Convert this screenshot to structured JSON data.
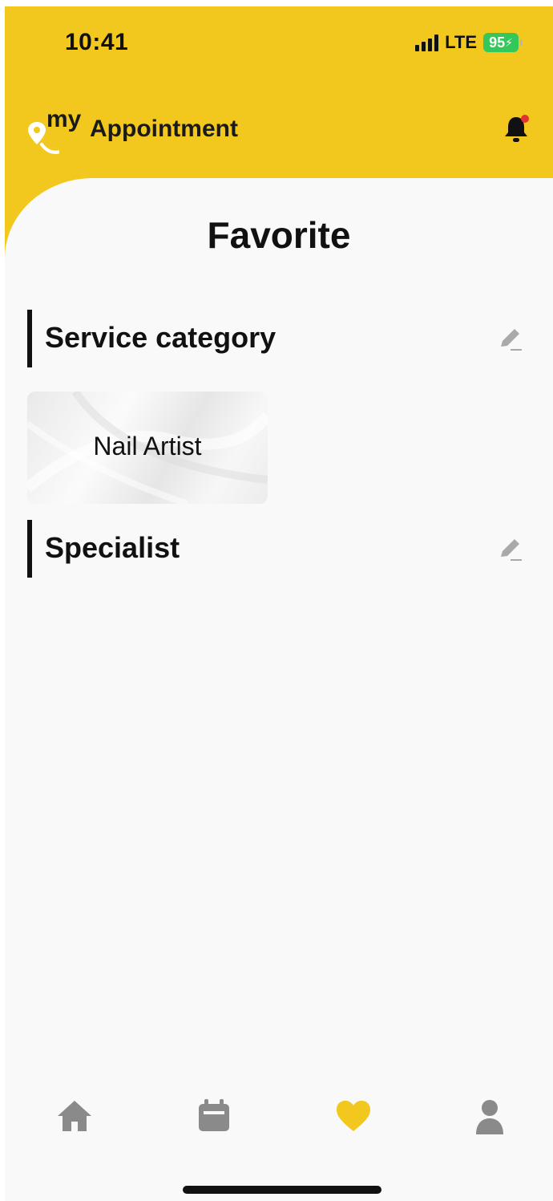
{
  "status_bar": {
    "time": "10:41",
    "network": "LTE",
    "battery": "95"
  },
  "header": {
    "logo_prefix": "my",
    "logo_main": "Appointment",
    "brand_color": "#f2c81e"
  },
  "page": {
    "title": "Favorite"
  },
  "sections": {
    "service_category": {
      "title": "Service category",
      "cards": [
        {
          "label": "Nail Artist"
        }
      ]
    },
    "specialist": {
      "title": "Specialist"
    }
  },
  "tabbar": {
    "items": [
      {
        "icon": "home-icon",
        "active": false
      },
      {
        "icon": "calendar-icon",
        "active": false
      },
      {
        "icon": "heart-icon",
        "active": true
      },
      {
        "icon": "profile-icon",
        "active": false
      }
    ],
    "active_color": "#f2c81e",
    "inactive_color": "#8a8a8a"
  }
}
